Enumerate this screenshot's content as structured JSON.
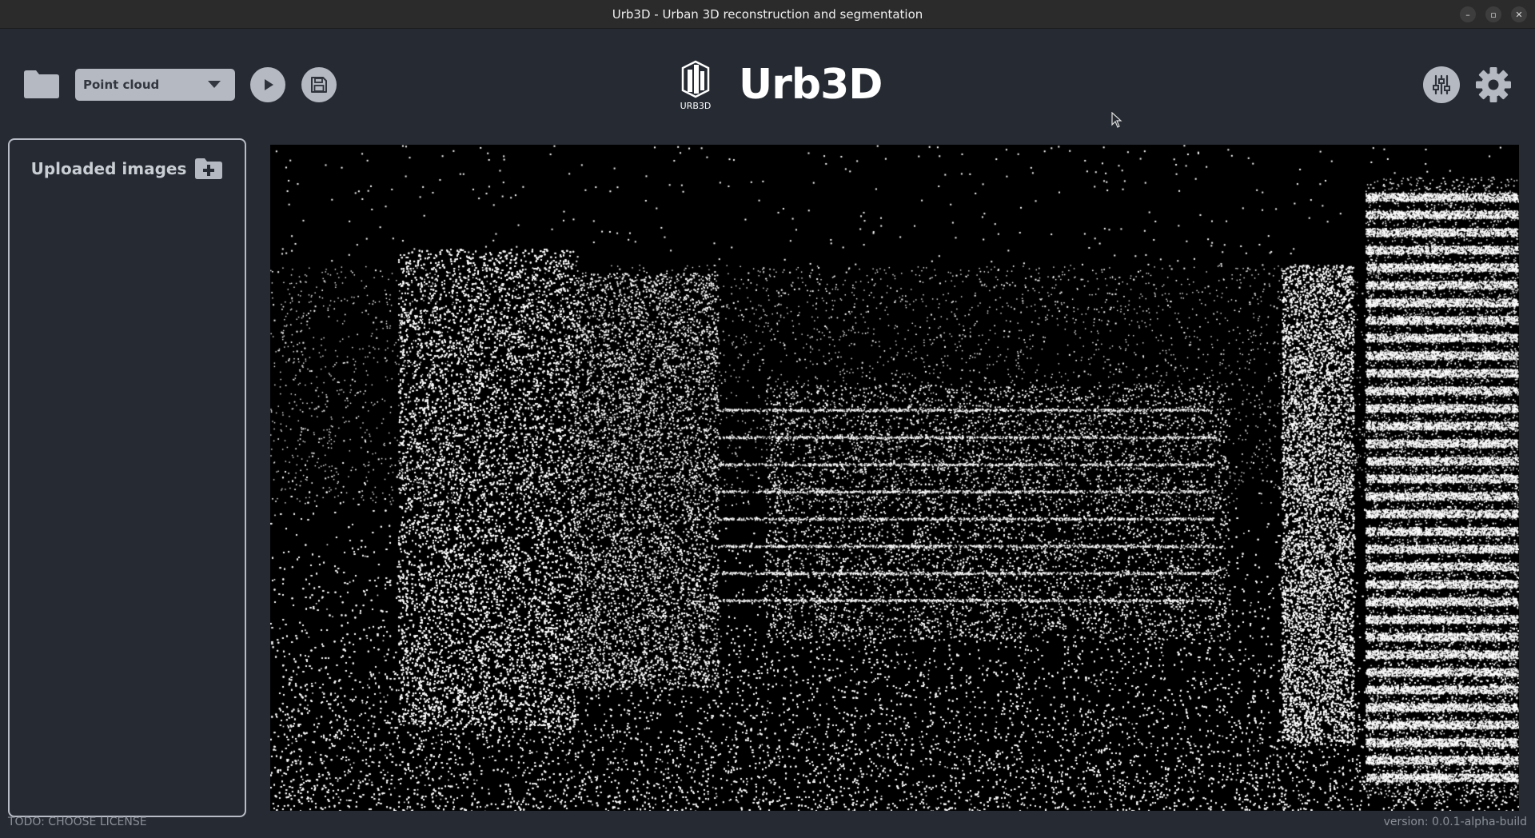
{
  "window": {
    "title": "Urb3D - Urban 3D reconstruction and segmentation",
    "controls": {
      "minimize": "–",
      "maximize": "▫",
      "close": "✕"
    }
  },
  "toolbar": {
    "view_mode": {
      "selected": "Point cloud"
    },
    "buttons": [
      "folder-icon",
      "play-icon",
      "save-icon",
      "sliders-icon",
      "gear-icon"
    ]
  },
  "brand": {
    "logo_text": "URB3D",
    "name": "Urb3D"
  },
  "sidebar": {
    "title": "Uploaded images"
  },
  "viewport": {
    "content": "point-cloud",
    "background": "#000000",
    "point_color": "#ffffff"
  },
  "footer": {
    "license": "TODO: CHOOSE LICENSE",
    "version": "version: 0.0.1-alpha-build"
  },
  "colors": {
    "background": "#262b33",
    "button": "#b5b9c2",
    "border": "#b7bcc6"
  }
}
